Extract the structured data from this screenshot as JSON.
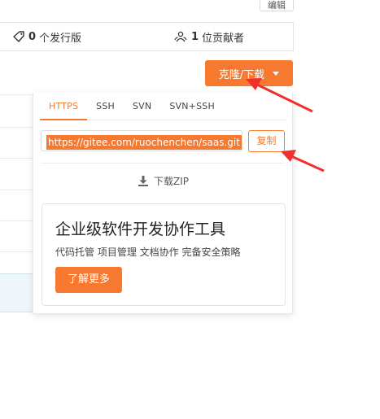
{
  "header": {
    "edit_label": "编辑"
  },
  "stats": {
    "releases_count": "0",
    "releases_label": "个发行版",
    "contributors_count": "1",
    "contributors_label": "位贡献者"
  },
  "clone_button": {
    "label": "克隆/下载"
  },
  "clone_panel": {
    "tabs": [
      {
        "label": "HTTPS",
        "active": true
      },
      {
        "label": "SSH",
        "active": false
      },
      {
        "label": "SVN",
        "active": false
      },
      {
        "label": "SVN+SSH",
        "active": false
      }
    ],
    "url": "https://gitee.com/ruochenchen/saas.git",
    "copy_label": "复制",
    "download_zip_label": "下载ZIP"
  },
  "promo": {
    "title": "企业级软件开发协作工具",
    "subtitle": "代码托管 项目管理 文档协作 完备安全策略",
    "button_label": "了解更多"
  },
  "colors": {
    "accent": "#f7792f",
    "annotation_arrow": "#f0302e"
  }
}
